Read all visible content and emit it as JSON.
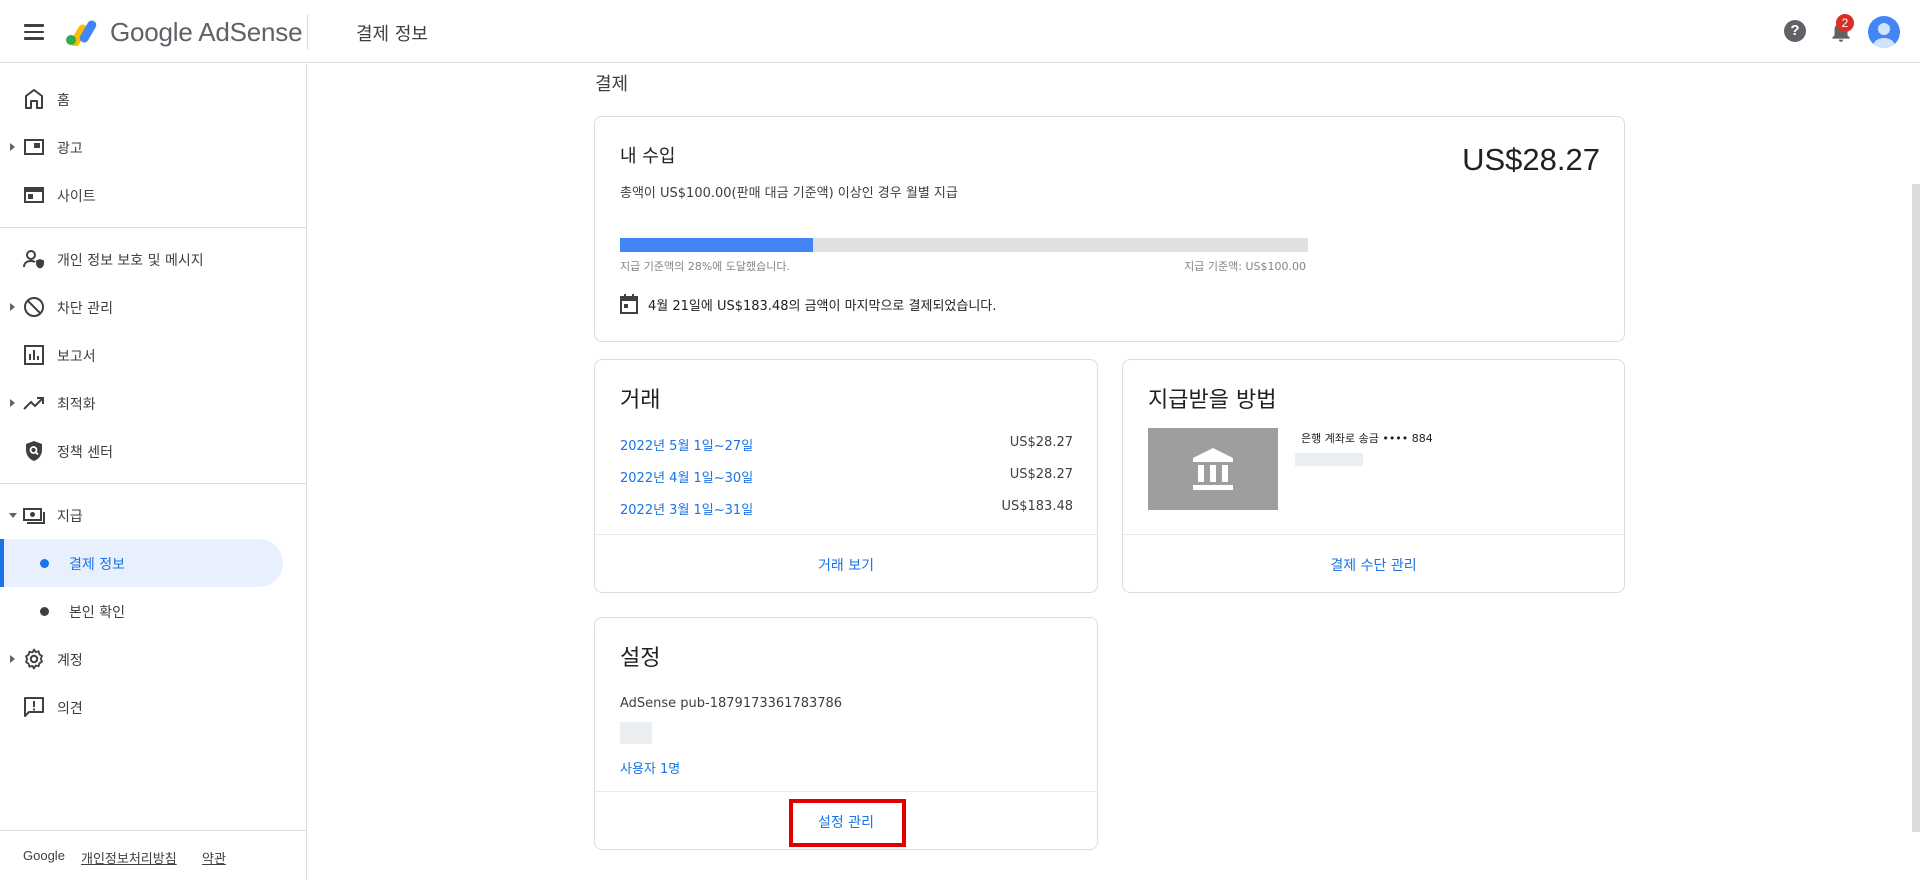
{
  "header": {
    "brand": "Google AdSense",
    "page_title": "결제 정보",
    "help_glyph": "?",
    "notifications_count": "2",
    "brand_colors": [
      "#fbbc04",
      "#4285f4",
      "#34a853"
    ]
  },
  "sidebar": {
    "items": [
      {
        "label": "홈",
        "icon": "home-icon"
      },
      {
        "label": "광고",
        "icon": "ads-icon"
      },
      {
        "label": "사이트",
        "icon": "sites-icon"
      },
      {
        "label": "개인 정보 보호 및 메시지",
        "icon": "privacy-icon"
      },
      {
        "label": "차단 관리",
        "icon": "block-icon"
      },
      {
        "label": "보고서",
        "icon": "reports-icon"
      },
      {
        "label": "최적화",
        "icon": "trending-icon"
      },
      {
        "label": "정책 센터",
        "icon": "policy-icon"
      },
      {
        "label": "지급",
        "icon": "payments-icon"
      },
      {
        "label": "결제 정보",
        "icon": "dot"
      },
      {
        "label": "본인 확인",
        "icon": "dot"
      },
      {
        "label": "계정",
        "icon": "gear-icon"
      },
      {
        "label": "의견",
        "icon": "feedback-icon"
      }
    ],
    "footer": {
      "google": "Google",
      "privacy_link": "개인정보처리방침",
      "terms_link": "약관"
    }
  },
  "main": {
    "section_title": "결제",
    "earnings": {
      "title": "내 수입",
      "amount": "US$28.27",
      "threshold_note": "총액이 US$100.00(판매 대금 기준액) 이상인 경우 월별 지급",
      "progress_fraction": 0.28,
      "progress_left": "지급 기준액의 28%에 도달했습니다.",
      "progress_right": "지급 기준액: US$100.00",
      "last_payment": "4월 21일에 US$183.48의 금액이 마지막으로 결제되었습니다."
    },
    "transactions": {
      "title": "거래",
      "rows": [
        {
          "date": "2022년 5월 1일~27일",
          "amount": "US$28.27"
        },
        {
          "date": "2022년 4월 1일~30일",
          "amount": "US$28.27"
        },
        {
          "date": "2022년 3월 1일~31일",
          "amount": "US$183.48"
        }
      ],
      "footer_link": "거래 보기"
    },
    "payment_method": {
      "title": "지급받을 방법",
      "bank_label": "은행 계좌로 송금 •••• 884",
      "footer_link": "결제 수단 관리"
    },
    "settings": {
      "title": "설정",
      "pub_id": "AdSense pub-1879173361783786",
      "users_link": "사용자 1명",
      "footer_link": "설정 관리"
    }
  },
  "colors": {
    "accent": "#1a73e8",
    "progress": "#4285f4",
    "active_bg": "#e8f0fe",
    "highlight": "#e00000",
    "badge": "#d93025"
  }
}
